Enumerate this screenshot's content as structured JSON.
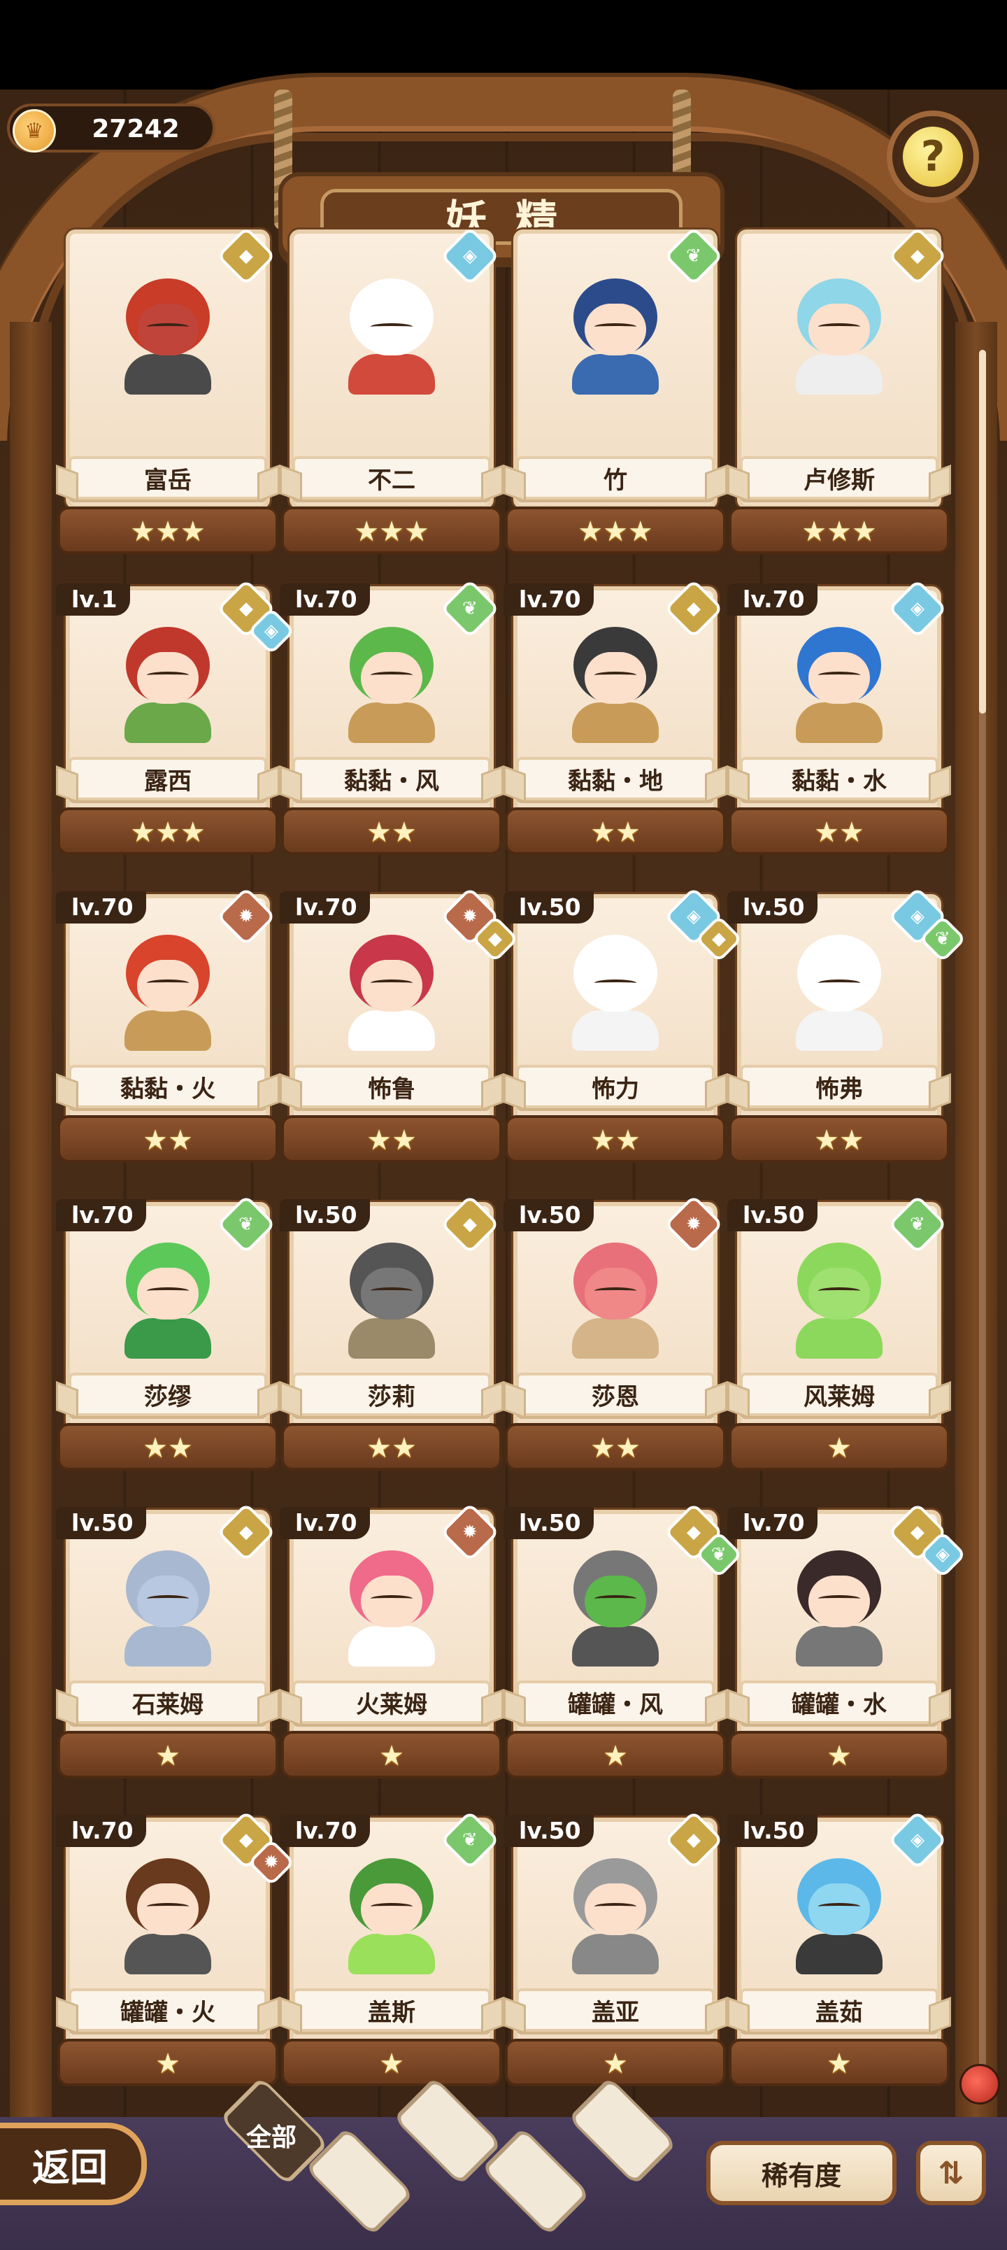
{
  "header": {
    "currency_value": "27242",
    "title": "妖精",
    "help_symbol": "?"
  },
  "cards": [
    {
      "name": "富岳",
      "level": "",
      "stars": "★★★",
      "elements": [
        "earth"
      ],
      "hair": "#c83c28",
      "skin": "#c0443a",
      "body": "#4a4a4a"
    },
    {
      "name": "不二",
      "level": "",
      "stars": "★★★",
      "elements": [
        "water"
      ],
      "hair": "#ffffff",
      "skin": "#ffffff",
      "body": "#d24a3c"
    },
    {
      "name": "竹",
      "level": "",
      "stars": "★★★",
      "elements": [
        "wind"
      ],
      "hair": "#2c4b8a",
      "skin": "#fce0cc",
      "body": "#3a6ab0"
    },
    {
      "name": "卢修斯",
      "level": "",
      "stars": "★★★",
      "elements": [
        "earth"
      ],
      "hair": "#8fd6e8",
      "skin": "#fce0cc",
      "body": "#eeeeee"
    },
    {
      "name": "露西",
      "level": "lv.1",
      "stars": "★★★",
      "elements": [
        "earth",
        "water"
      ],
      "hair": "#c0382c",
      "skin": "#fce0cc",
      "body": "#6aa84a"
    },
    {
      "name": "黏黏・风",
      "level": "lv.70",
      "stars": "★★",
      "elements": [
        "wind"
      ],
      "hair": "#5cb84a",
      "skin": "#fce0cc",
      "body": "#c89c58"
    },
    {
      "name": "黏黏・地",
      "level": "lv.70",
      "stars": "★★",
      "elements": [
        "earth"
      ],
      "hair": "#3a3a3a",
      "skin": "#fce0cc",
      "body": "#c89c58"
    },
    {
      "name": "黏黏・水",
      "level": "lv.70",
      "stars": "★★",
      "elements": [
        "water"
      ],
      "hair": "#2f76d0",
      "skin": "#fce0cc",
      "body": "#c89c58"
    },
    {
      "name": "黏黏・火",
      "level": "lv.70",
      "stars": "★★",
      "elements": [
        "fire"
      ],
      "hair": "#d8442c",
      "skin": "#fce0cc",
      "body": "#c89c58"
    },
    {
      "name": "怖鲁",
      "level": "lv.70",
      "stars": "★★",
      "elements": [
        "fire",
        "earth"
      ],
      "hair": "#c8384a",
      "skin": "#fce0cc",
      "body": "#ffffff"
    },
    {
      "name": "怖力",
      "level": "lv.50",
      "stars": "★★",
      "elements": [
        "water",
        "earth"
      ],
      "hair": "#ffffff",
      "skin": "#ffffff",
      "body": "#f4f4f4"
    },
    {
      "name": "怖弗",
      "level": "lv.50",
      "stars": "★★",
      "elements": [
        "water",
        "wind"
      ],
      "hair": "#ffffff",
      "skin": "#ffffff",
      "body": "#f4f4f4"
    },
    {
      "name": "莎缪",
      "level": "lv.70",
      "stars": "★★",
      "elements": [
        "wind"
      ],
      "hair": "#5cc85a",
      "skin": "#fce0cc",
      "body": "#3a9a4a"
    },
    {
      "name": "莎莉",
      "level": "lv.50",
      "stars": "★★",
      "elements": [
        "earth"
      ],
      "hair": "#555555",
      "skin": "#777777",
      "body": "#9a8a6a"
    },
    {
      "name": "莎恩",
      "level": "lv.50",
      "stars": "★★",
      "elements": [
        "fire"
      ],
      "hair": "#e8707a",
      "skin": "#f08888",
      "body": "#d4b488"
    },
    {
      "name": "风莱姆",
      "level": "lv.50",
      "stars": "★",
      "elements": [
        "wind"
      ],
      "hair": "#8cd85c",
      "skin": "#a0e070",
      "body": "#8cd85c"
    },
    {
      "name": "石莱姆",
      "level": "lv.50",
      "stars": "★",
      "elements": [
        "earth"
      ],
      "hair": "#a8b8d0",
      "skin": "#b8c8e0",
      "body": "#a8b8d0"
    },
    {
      "name": "火莱姆",
      "level": "lv.70",
      "stars": "★",
      "elements": [
        "fire"
      ],
      "hair": "#f06a8a",
      "skin": "#fce0cc",
      "body": "#ffffff"
    },
    {
      "name": "罐罐・风",
      "level": "lv.50",
      "stars": "★",
      "elements": [
        "earth",
        "wind"
      ],
      "hair": "#777777",
      "skin": "#5cb84a",
      "body": "#555555"
    },
    {
      "name": "罐罐・水",
      "level": "lv.70",
      "stars": "★",
      "elements": [
        "earth",
        "water"
      ],
      "hair": "#3a2a2a",
      "skin": "#fce0cc",
      "body": "#777777"
    },
    {
      "name": "罐罐・火",
      "level": "lv.70",
      "stars": "★",
      "elements": [
        "earth",
        "fire"
      ],
      "hair": "#6a3a1e",
      "skin": "#fce0cc",
      "body": "#555555"
    },
    {
      "name": "盖斯",
      "level": "lv.70",
      "stars": "★",
      "elements": [
        "wind"
      ],
      "hair": "#4a9a3a",
      "skin": "#fce0cc",
      "body": "#9ae05a"
    },
    {
      "name": "盖亚",
      "level": "lv.50",
      "stars": "★",
      "elements": [
        "earth"
      ],
      "hair": "#9a9a9a",
      "skin": "#fce0cc",
      "body": "#888888"
    },
    {
      "name": "盖茹",
      "level": "lv.50",
      "stars": "★",
      "elements": [
        "water"
      ],
      "hair": "#5cb8e8",
      "skin": "#8fd6f0",
      "body": "#3a3a3a"
    }
  ],
  "footer": {
    "back_label": "返回",
    "tab_all_label": "全部",
    "rarity_label": "稀有度",
    "sort_icon": "sort-icon"
  }
}
